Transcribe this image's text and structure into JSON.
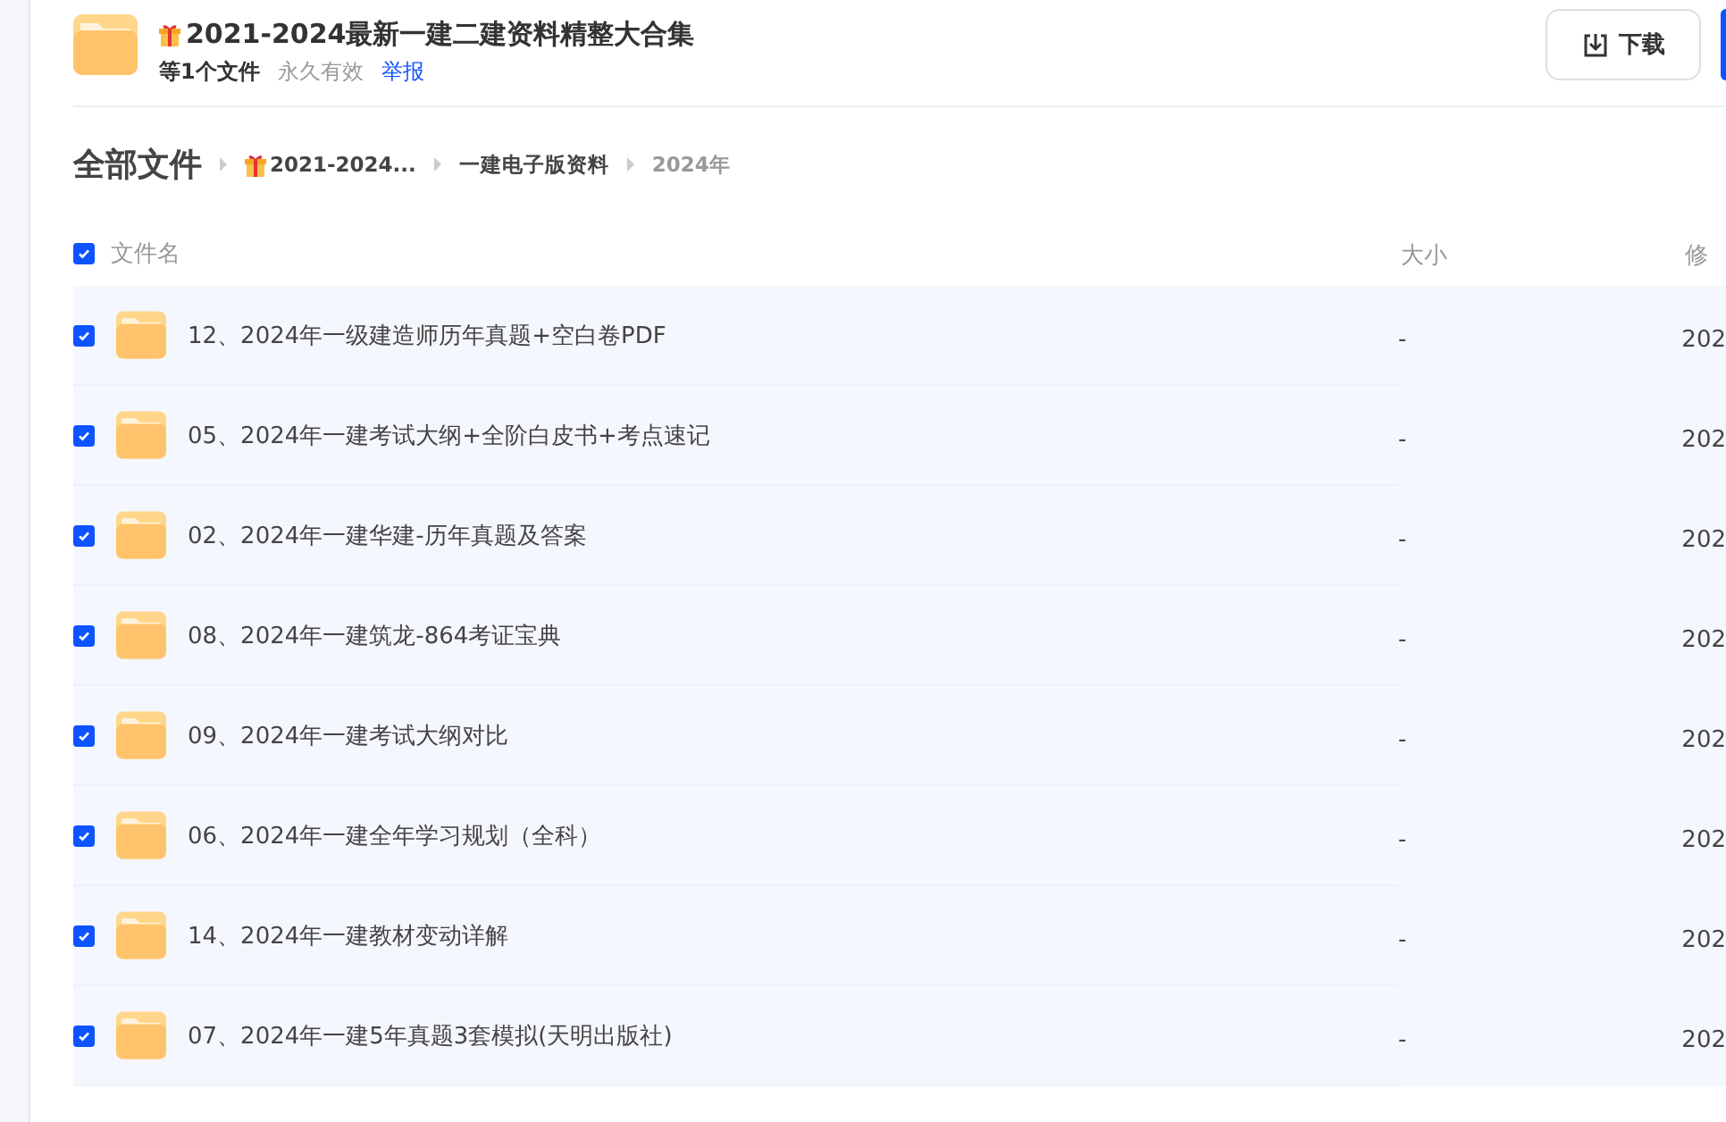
{
  "share": {
    "title": "2021-2024最新一建二建资料精整大合集",
    "file_count": "等1个文件",
    "validity": "永久有效",
    "report_link": "举报",
    "download_button": "下载"
  },
  "breadcrumb": {
    "root": "全部文件",
    "items": [
      {
        "label": "2021-2024...",
        "gift": true
      },
      {
        "label": "一建电子版资料",
        "gift": false
      },
      {
        "label": "2024年",
        "gift": false
      }
    ]
  },
  "table": {
    "all_checked": true,
    "columns": [
      "文件名",
      "大小",
      "修"
    ],
    "rows": [
      {
        "checked": true,
        "name": "12、2024年一级建造师历年真题+空白卷PDF",
        "size": "-",
        "date": "202"
      },
      {
        "checked": true,
        "name": "05、2024年一建考试大纲+全阶白皮书+考点速记",
        "size": "-",
        "date": "202"
      },
      {
        "checked": true,
        "name": "02、2024年一建华建-历年真题及答案",
        "size": "-",
        "date": "202"
      },
      {
        "checked": true,
        "name": "08、2024年一建筑龙-864考证宝典",
        "size": "-",
        "date": "202"
      },
      {
        "checked": true,
        "name": "09、2024年一建考试大纲对比",
        "size": "-",
        "date": "202"
      },
      {
        "checked": true,
        "name": "06、2024年一建全年学习规划（全科）",
        "size": "-",
        "date": "202"
      },
      {
        "checked": true,
        "name": "14、2024年一建教材变动详解",
        "size": "-",
        "date": "202"
      },
      {
        "checked": true,
        "name": "07、2024年一建5年真题3套模拟(天明出版社)",
        "size": "-",
        "date": "202"
      }
    ]
  }
}
